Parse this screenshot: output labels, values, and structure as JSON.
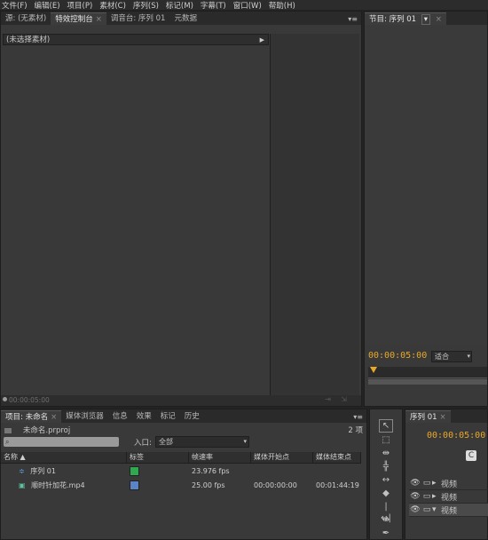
{
  "menu": [
    "文件(F)",
    "编辑(E)",
    "项目(P)",
    "素材(C)",
    "序列(S)",
    "标记(M)",
    "字幕(T)",
    "窗口(W)",
    "帮助(H)"
  ],
  "source_panel": {
    "tabs": [
      {
        "label": "源: (无素材)"
      },
      {
        "label": "特效控制台",
        "close": "×"
      },
      {
        "label": "调音台: 序列 01"
      },
      {
        "label": "元数据"
      }
    ],
    "header": "(未选择素材)",
    "timecode": "00:00:05:00"
  },
  "program_panel": {
    "tab": "节目: 序列 01",
    "timecode": "00:00:05:00",
    "fit": "适合"
  },
  "project_panel": {
    "tabs": [
      {
        "label": "项目: 未命名",
        "close": "×"
      },
      {
        "label": "媒体浏览器"
      },
      {
        "label": "信息"
      },
      {
        "label": "效果"
      },
      {
        "label": "标记"
      },
      {
        "label": "历史"
      }
    ],
    "file": "未命名.prproj",
    "count": "2 项",
    "search_placeholder": "",
    "entry_label": "入口:",
    "entry_value": "全部",
    "columns": [
      "名称",
      "标签",
      "帧速率",
      "媒体开始点",
      "媒体结束点"
    ],
    "rows": [
      {
        "name": "序列 01",
        "label_color": "#2fa84f",
        "fps": "23.976 fps",
        "start": "",
        "end": ""
      },
      {
        "name": "顺时针加花.mp4",
        "label_color": "#5b84c4",
        "fps": "25.00 fps",
        "start": "00:00:00:00",
        "end": "00:01:44:19"
      }
    ]
  },
  "timeline_panel": {
    "tab": "序列 01",
    "timecode": "00:00:05:00",
    "tracks": [
      "视频",
      "视频",
      "视频"
    ]
  },
  "colors": {
    "timecode": "#e8a92a",
    "panel": "#393939",
    "background": "#232323"
  }
}
